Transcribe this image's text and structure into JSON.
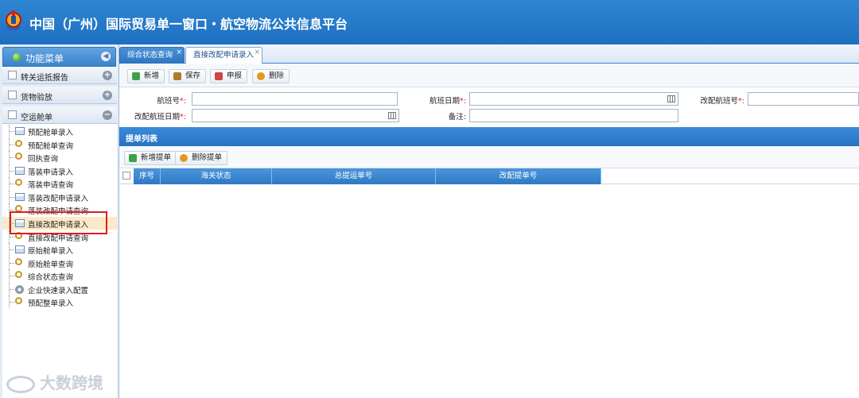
{
  "header": {
    "title": "中国（广州）国际贸易单一窗口・航空物流公共信息平台"
  },
  "sidebar": {
    "title": "功能菜单",
    "groups": [
      {
        "label": "转关运抵报告",
        "toggle": "+"
      },
      {
        "label": "货物验放",
        "toggle": "+"
      },
      {
        "label": "空运舱单",
        "toggle": "−"
      }
    ],
    "items": [
      {
        "label": "预配舱单录入",
        "icon": "form-icon"
      },
      {
        "label": "预配舱单查询",
        "icon": "search-icon"
      },
      {
        "label": "回执查询",
        "icon": "search-icon"
      },
      {
        "label": "落装申请录入",
        "icon": "form-icon"
      },
      {
        "label": "落装申请查询",
        "icon": "search-icon"
      },
      {
        "label": "落装改配申请录入",
        "icon": "form-icon"
      },
      {
        "label": "落装改配申请查询",
        "icon": "search-icon"
      },
      {
        "label": "直接改配申请录入",
        "icon": "form-icon"
      },
      {
        "label": "直接改配申请查询",
        "icon": "search-icon"
      },
      {
        "label": "原始舱单录入",
        "icon": "form-icon"
      },
      {
        "label": "原始舱单查询",
        "icon": "search-icon"
      },
      {
        "label": "综合状态查询",
        "icon": "search-icon"
      },
      {
        "label": "企业快速录入配置",
        "icon": "gear-icon"
      },
      {
        "label": "预配整单录入",
        "icon": "search-icon"
      }
    ]
  },
  "tabs": [
    {
      "label": "综合状态查询"
    },
    {
      "label": "直接改配申请录入"
    }
  ],
  "toolbar": {
    "add": "新增",
    "save": "保存",
    "submit": "申报",
    "delete": "删除"
  },
  "form": {
    "flight_no": "航班号",
    "flight_date": "航班日期",
    "new_flight_no": "改配航班号",
    "new_flight_date": "改配航班日期",
    "remark": "备注",
    "required_mark": "*:"
  },
  "section": {
    "title": "提单列表",
    "add_bill": "新增提单",
    "delete_bill": "删除提单"
  },
  "grid": {
    "columns": [
      "序号",
      "海关状态",
      "总提运单号",
      "改配提单号"
    ]
  },
  "watermark": "大数跨境",
  "colors": {
    "header": "#1e6fc0",
    "highlight": "#e01c1c"
  }
}
